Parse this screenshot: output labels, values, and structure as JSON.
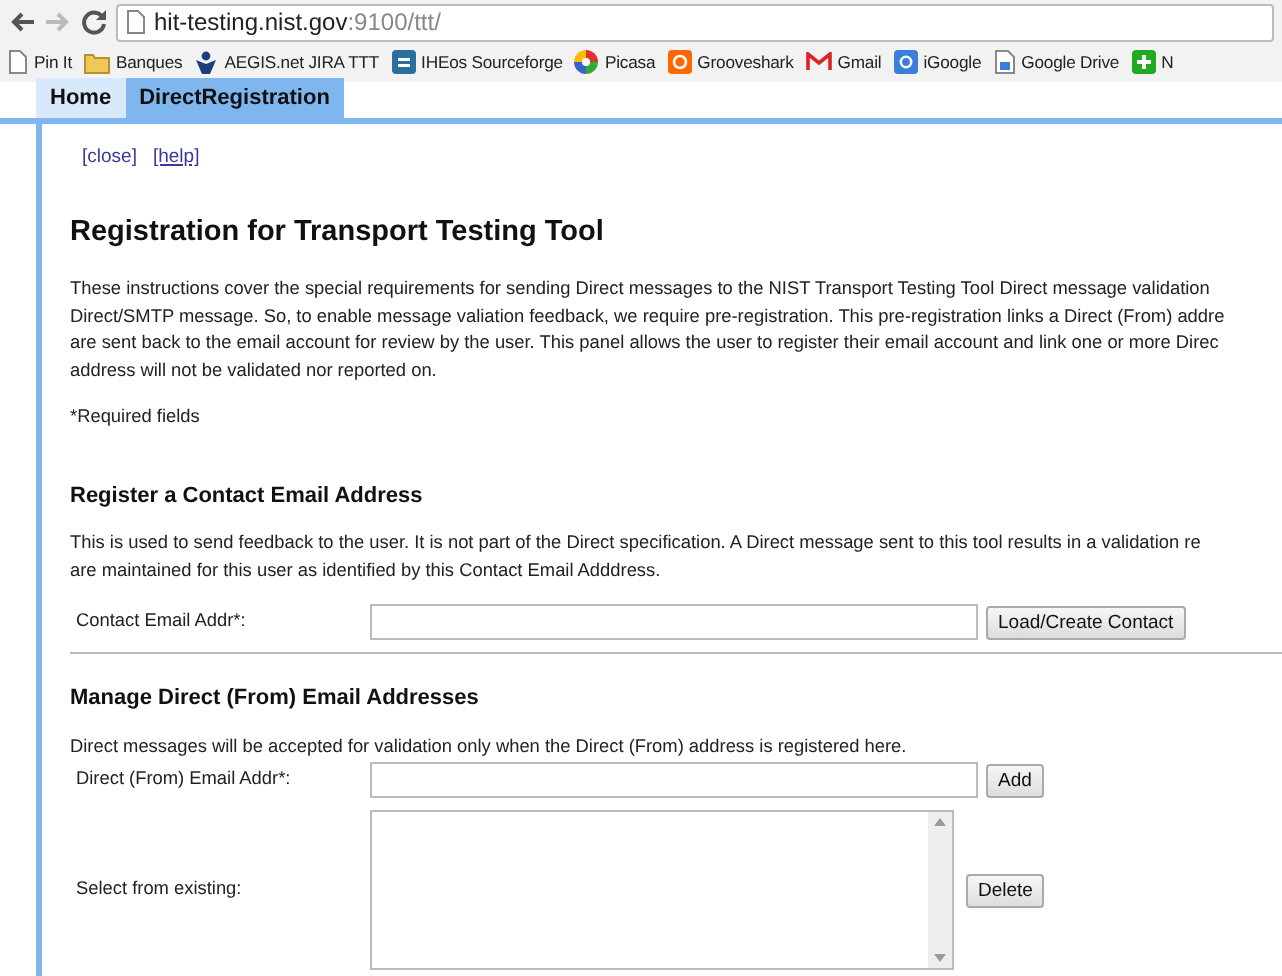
{
  "browser": {
    "url_host": "hit-testing.nist.gov",
    "url_rest": ":9100/ttt/",
    "bookmarks": [
      {
        "label": "Pin It",
        "kind": "page"
      },
      {
        "label": "Banques",
        "kind": "folder"
      },
      {
        "label": "AEGIS.net JIRA TTT",
        "kind": "aegis"
      },
      {
        "label": "IHEos Sourceforge",
        "kind": "sf"
      },
      {
        "label": "Picasa",
        "kind": "picasa"
      },
      {
        "label": "Grooveshark",
        "kind": "shark"
      },
      {
        "label": "Gmail",
        "kind": "gmail"
      },
      {
        "label": "iGoogle",
        "kind": "igoogle"
      },
      {
        "label": "Google Drive",
        "kind": "drive"
      },
      {
        "label": "N",
        "kind": "plus"
      }
    ]
  },
  "tabs": [
    {
      "label": "Home",
      "selected": false
    },
    {
      "label": "DirectRegistration",
      "selected": true
    }
  ],
  "links": [
    "[close]",
    "[help]"
  ],
  "title": "Registration for Transport Testing Tool",
  "intro": [
    "These instructions cover the special requirements for sending Direct messages to the NIST Transport Testing Tool Direct message validation",
    "Direct/SMTP message. So, to enable message valiation feedback, we require pre-registration. This pre-registration links a Direct (From) addre",
    "are sent back to the email account for review by the user. This panel allows the user to register their email account and link one or more Direc",
    "address will not be validated nor reported on."
  ],
  "required_note": "*Required fields",
  "contact_section": {
    "heading": "Register a Contact Email Address",
    "description": [
      "This is used to send feedback to the user. It is not part of the Direct specification. A Direct message sent to this tool results in a validation re",
      "are maintained for this user as identified by this Contact Email Adddress."
    ],
    "field_label": "Contact Email Addr*:",
    "button": "Load/Create Contact"
  },
  "direct_section": {
    "heading": "Manage Direct (From) Email Addresses",
    "description": "Direct messages will be accepted for validation only when the Direct (From) address is registered here.",
    "field_label": "Direct (From) Email Addr*:",
    "add_button": "Add",
    "select_label": "Select from existing:",
    "delete_button": "Delete"
  }
}
